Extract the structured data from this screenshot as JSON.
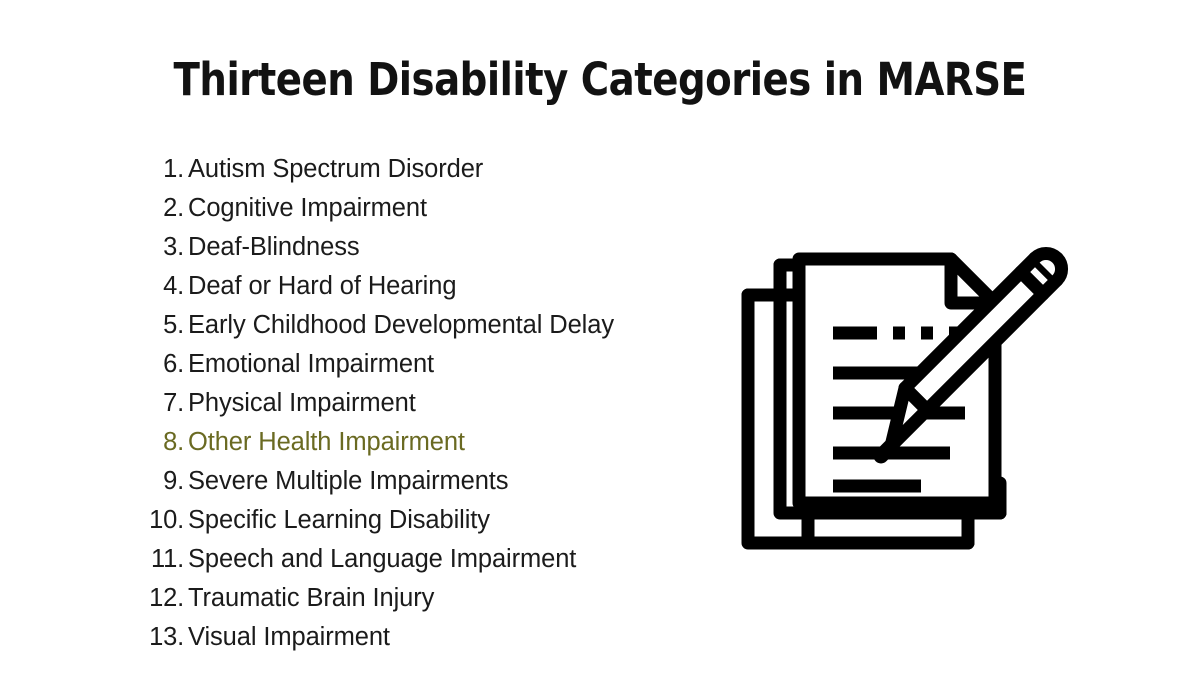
{
  "slide": {
    "background_color": "#ffffff",
    "title": "Thirteen Disability Categories in MARSE"
  },
  "list": {
    "highlight_color": "#f7f3a2",
    "highlight_text_color": "#6a6a22",
    "text_color": "#1b1b1b",
    "items": [
      {
        "number": "1.",
        "label": "Autism Spectrum Disorder",
        "highlighted": false
      },
      {
        "number": "2.",
        "label": "Cognitive Impairment",
        "highlighted": false
      },
      {
        "number": "3.",
        "label": "Deaf-Blindness",
        "highlighted": false
      },
      {
        "number": "4.",
        "label": "Deaf or Hard of Hearing",
        "highlighted": false
      },
      {
        "number": "5.",
        "label": "Early Childhood Developmental Delay",
        "highlighted": false
      },
      {
        "number": "6.",
        "label": "Emotional Impairment",
        "highlighted": false
      },
      {
        "number": "7.",
        "label": "Physical Impairment",
        "highlighted": false
      },
      {
        "number": "8.",
        "label": "Other Health Impairment",
        "highlighted": true
      },
      {
        "number": "9.",
        "label": "Severe Multiple Impairments",
        "highlighted": false
      },
      {
        "number": "10.",
        "label": "Specific Learning Disability",
        "highlighted": false
      },
      {
        "number": "11.",
        "label": "Speech and Language Impairment",
        "highlighted": false
      },
      {
        "number": "12.",
        "label": "Traumatic Brain Injury",
        "highlighted": false
      },
      {
        "number": "13.",
        "label": "Visual Impairment",
        "highlighted": false
      }
    ]
  },
  "illustration": {
    "name": "documents-and-pencil-icon",
    "stroke_color": "#000000",
    "fill_color": "#ffffff"
  }
}
